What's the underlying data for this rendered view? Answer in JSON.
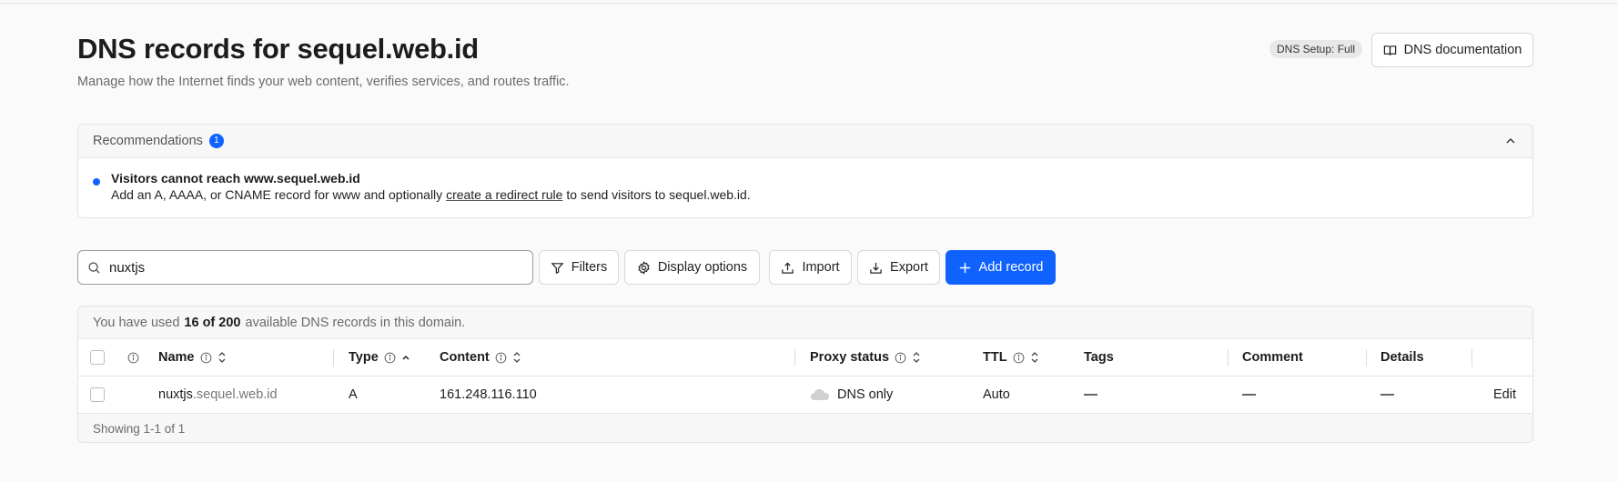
{
  "header": {
    "title": "DNS records for sequel.web.id",
    "subtitle": "Manage how the Internet finds your web content, verifies services, and routes traffic.",
    "setup_badge": "DNS Setup: Full",
    "doc_button": "DNS documentation"
  },
  "recommendations": {
    "title": "Recommendations",
    "count": "1",
    "item": {
      "title": "Visitors cannot reach www.sequel.web.id",
      "text_before": "Add an A, AAAA, or CNAME record for www and optionally ",
      "link": "create a redirect rule",
      "text_after": " to send visitors to sequel.web.id."
    }
  },
  "toolbar": {
    "search_value": "nuxtjs",
    "filters": "Filters",
    "display_options": "Display options",
    "import": "Import",
    "export": "Export",
    "add_record": "Add record"
  },
  "usage": {
    "before": "You have used",
    "count": "16 of 200",
    "after": "available DNS records in this domain."
  },
  "table": {
    "columns": [
      "Name",
      "Type",
      "Content",
      "Proxy status",
      "TTL",
      "Tags",
      "Comment",
      "Details"
    ],
    "rows": [
      {
        "name_sub": "nuxtjs",
        "name_domain": ".sequel.web.id",
        "type": "A",
        "content": "161.248.116.110",
        "proxy_status": "DNS only",
        "ttl": "Auto",
        "edit": "Edit"
      }
    ],
    "footer": "Showing 1-1 of 1"
  },
  "colors": {
    "accent": "#1062fe",
    "background": "#fafafa"
  }
}
